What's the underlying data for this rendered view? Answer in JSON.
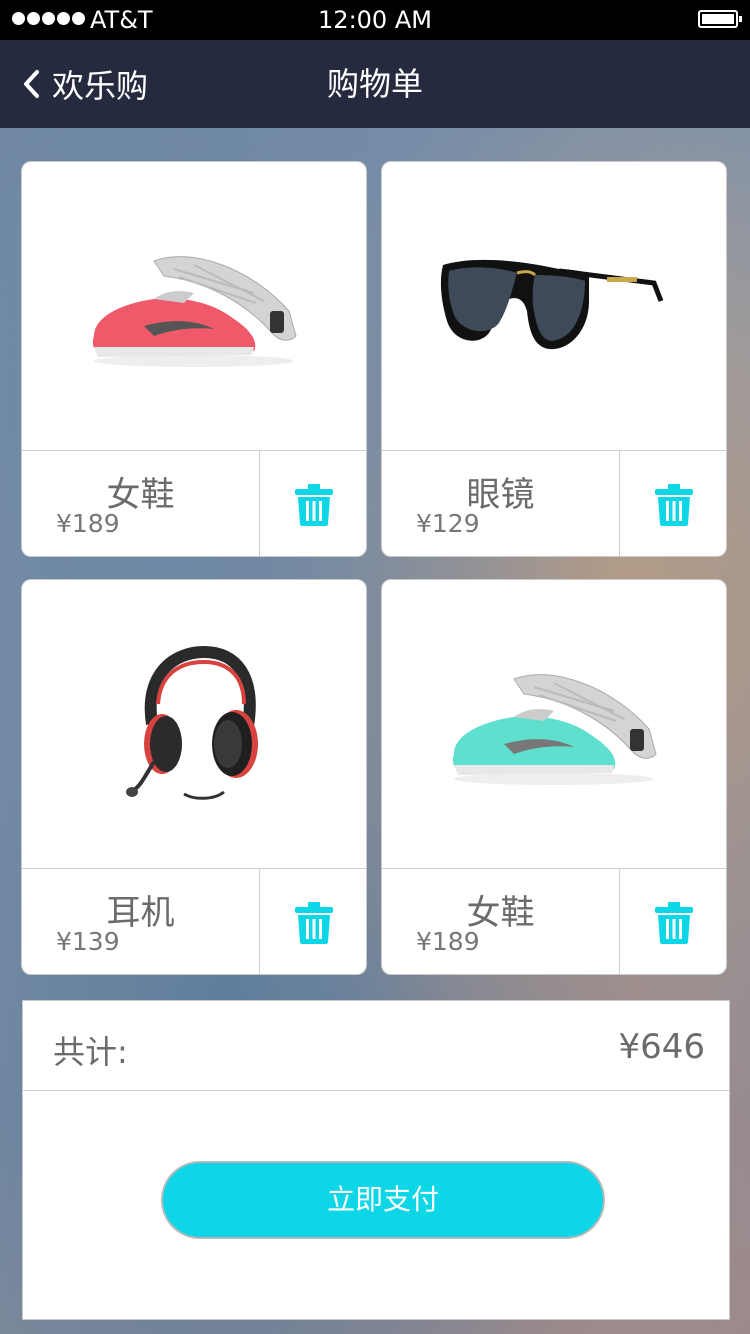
{
  "status_bar": {
    "carrier": "AT&T",
    "time": "12:00 AM"
  },
  "nav": {
    "back_label": "欢乐购",
    "title": "购物单"
  },
  "items": [
    {
      "name": "女鞋",
      "price": "¥189",
      "image": "shoe-coral-icon",
      "color": "#f0596a"
    },
    {
      "name": "眼镜",
      "price": "¥129",
      "image": "sunglasses-icon",
      "color": "#1a1a1a"
    },
    {
      "name": "耳机",
      "price": "¥139",
      "image": "headphones-icon",
      "color": "#d9433f"
    },
    {
      "name": "女鞋",
      "price": "¥189",
      "image": "shoe-mint-icon",
      "color": "#5fe0cf"
    }
  ],
  "summary": {
    "total_label": "共计:",
    "total_value": "¥646",
    "pay_label": "立即支付"
  },
  "colors": {
    "accent": "#0dd6e6",
    "nav_bg": "#262a3f",
    "text": "#6b6b6b"
  }
}
